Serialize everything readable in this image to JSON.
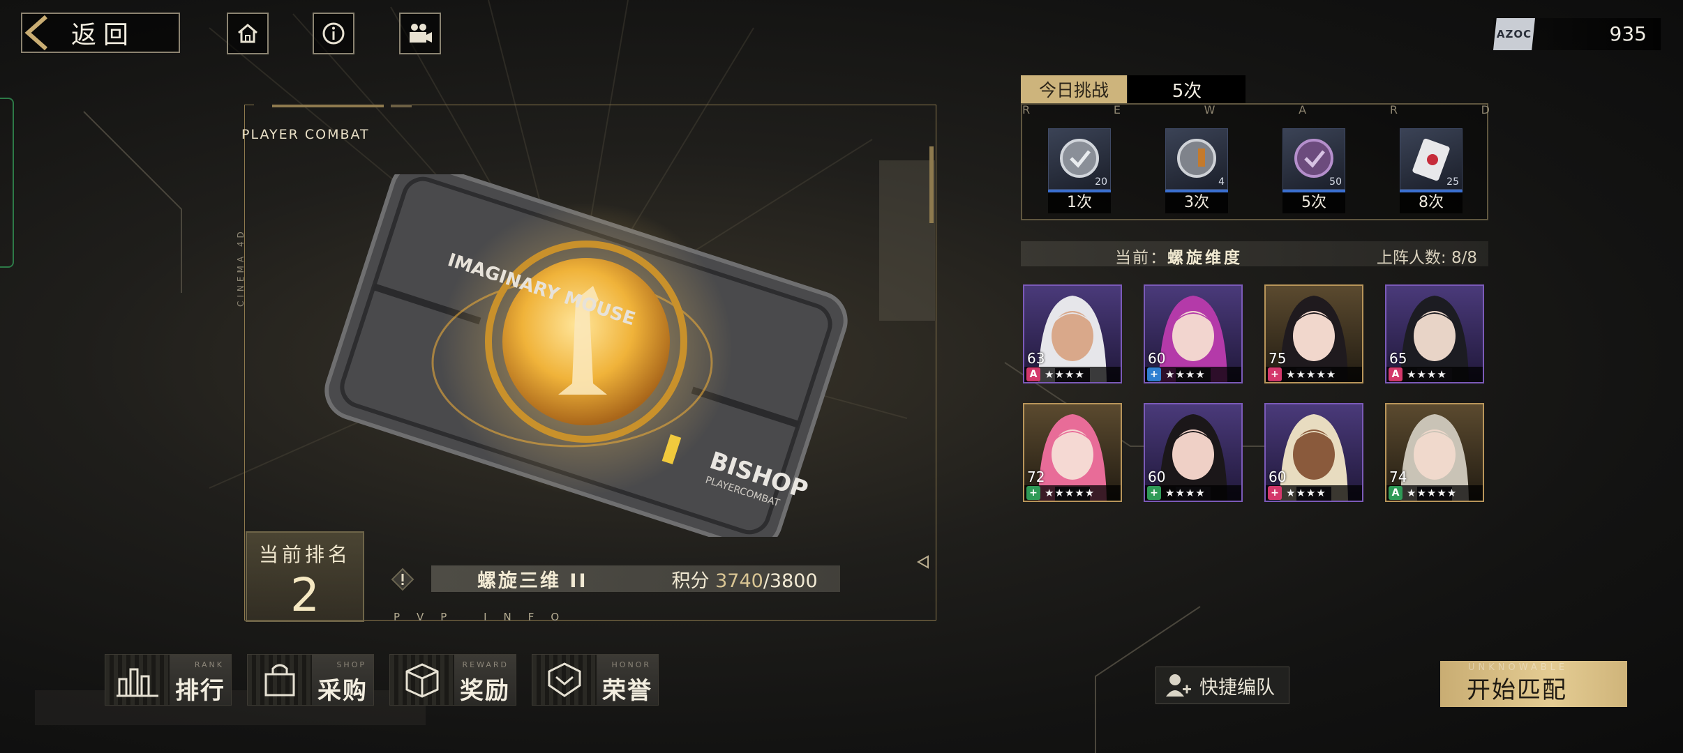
{
  "top_bar": {
    "back_label": "返回",
    "currency": {
      "chip_label": "AZOC",
      "value": "935"
    }
  },
  "card_area": {
    "frame_label": "PLAYER COMBAT",
    "side_label": "CINEMA 4D",
    "footer_label": "PVP INFO",
    "card_name_top": "IMAGINARY MOUSE",
    "card_brand": "BISHOP",
    "card_brand_sub": "PLAYERCOMBAT"
  },
  "rank": {
    "title": "当前排名",
    "value": "2"
  },
  "season": {
    "name": "螺旋三维 II",
    "score_label": "积分",
    "score_current": "3740",
    "score_total": "/3800"
  },
  "bottom_menu": [
    {
      "en": "RANK",
      "cn": "排行",
      "icon": "bar-chart-icon"
    },
    {
      "en": "SHOP",
      "cn": "采购",
      "icon": "shopping-bag-icon"
    },
    {
      "en": "REWARD",
      "cn": "奖励",
      "icon": "cube-icon"
    },
    {
      "en": "HONOR",
      "cn": "荣誉",
      "icon": "badge-chevron-icon"
    }
  ],
  "challenge": {
    "tab_label": "今日挑战",
    "count": "5次",
    "letters": [
      "R",
      "E",
      "W",
      "A",
      "R",
      "D"
    ],
    "rewards": [
      {
        "qty": "20",
        "times": "1次",
        "icon": "medal-coin-icon"
      },
      {
        "qty": "4",
        "times": "3次",
        "icon": "trophy-coin-icon"
      },
      {
        "qty": "50",
        "times": "5次",
        "icon": "purple-coin-icon"
      },
      {
        "qty": "25",
        "times": "8次",
        "icon": "ticket-icon"
      }
    ]
  },
  "lineup": {
    "current_label": "当前：",
    "current_value": "螺旋维度",
    "count_label": "上阵人数:",
    "count_value": "8/8"
  },
  "characters": [
    {
      "level": "63",
      "stars": "★★★★",
      "frame": "purple",
      "cls": "A",
      "cls_color": "#d4386b",
      "hair": "#e6e6ea",
      "skin": "#d9a88a"
    },
    {
      "level": "60",
      "stars": "★★★★",
      "frame": "purple",
      "cls": "+",
      "cls_color": "#2f7fd1",
      "hair": "#b43aa9",
      "skin": "#f2d5cf"
    },
    {
      "level": "75",
      "stars": "★★★★★",
      "frame": "gold",
      "cls": "+",
      "cls_color": "#d4386b",
      "hair": "#1f1a1e",
      "skin": "#f1d7cc"
    },
    {
      "level": "65",
      "stars": "★★★★",
      "frame": "purple",
      "cls": "A",
      "cls_color": "#d4386b",
      "hair": "#1c1c22",
      "skin": "#e8d4c7"
    },
    {
      "level": "72",
      "stars": "★★★★★",
      "frame": "gold",
      "cls": "+",
      "cls_color": "#2f9a57",
      "hair": "#e86c98",
      "skin": "#f5d9d3"
    },
    {
      "level": "60",
      "stars": "★★★★",
      "frame": "purple",
      "cls": "+",
      "cls_color": "#2f9a57",
      "hair": "#1b1719",
      "skin": "#efd0c6"
    },
    {
      "level": "60",
      "stars": "★★★★",
      "frame": "purple",
      "cls": "+",
      "cls_color": "#d4386b",
      "hair": "#e8dcc0",
      "skin": "#8a5a3c"
    },
    {
      "level": "74",
      "stars": "★★★★★",
      "frame": "gold",
      "cls": "A",
      "cls_color": "#2f9a57",
      "hair": "#c9c3b6",
      "skin": "#f0d9cc"
    }
  ],
  "actions": {
    "quick_team": "快捷编队",
    "start_sub": "UNKNOWABLE",
    "start_label": "开始匹配"
  },
  "colors": {
    "gold": "#cdb47c",
    "frame_gold": "#8e7a4e"
  }
}
